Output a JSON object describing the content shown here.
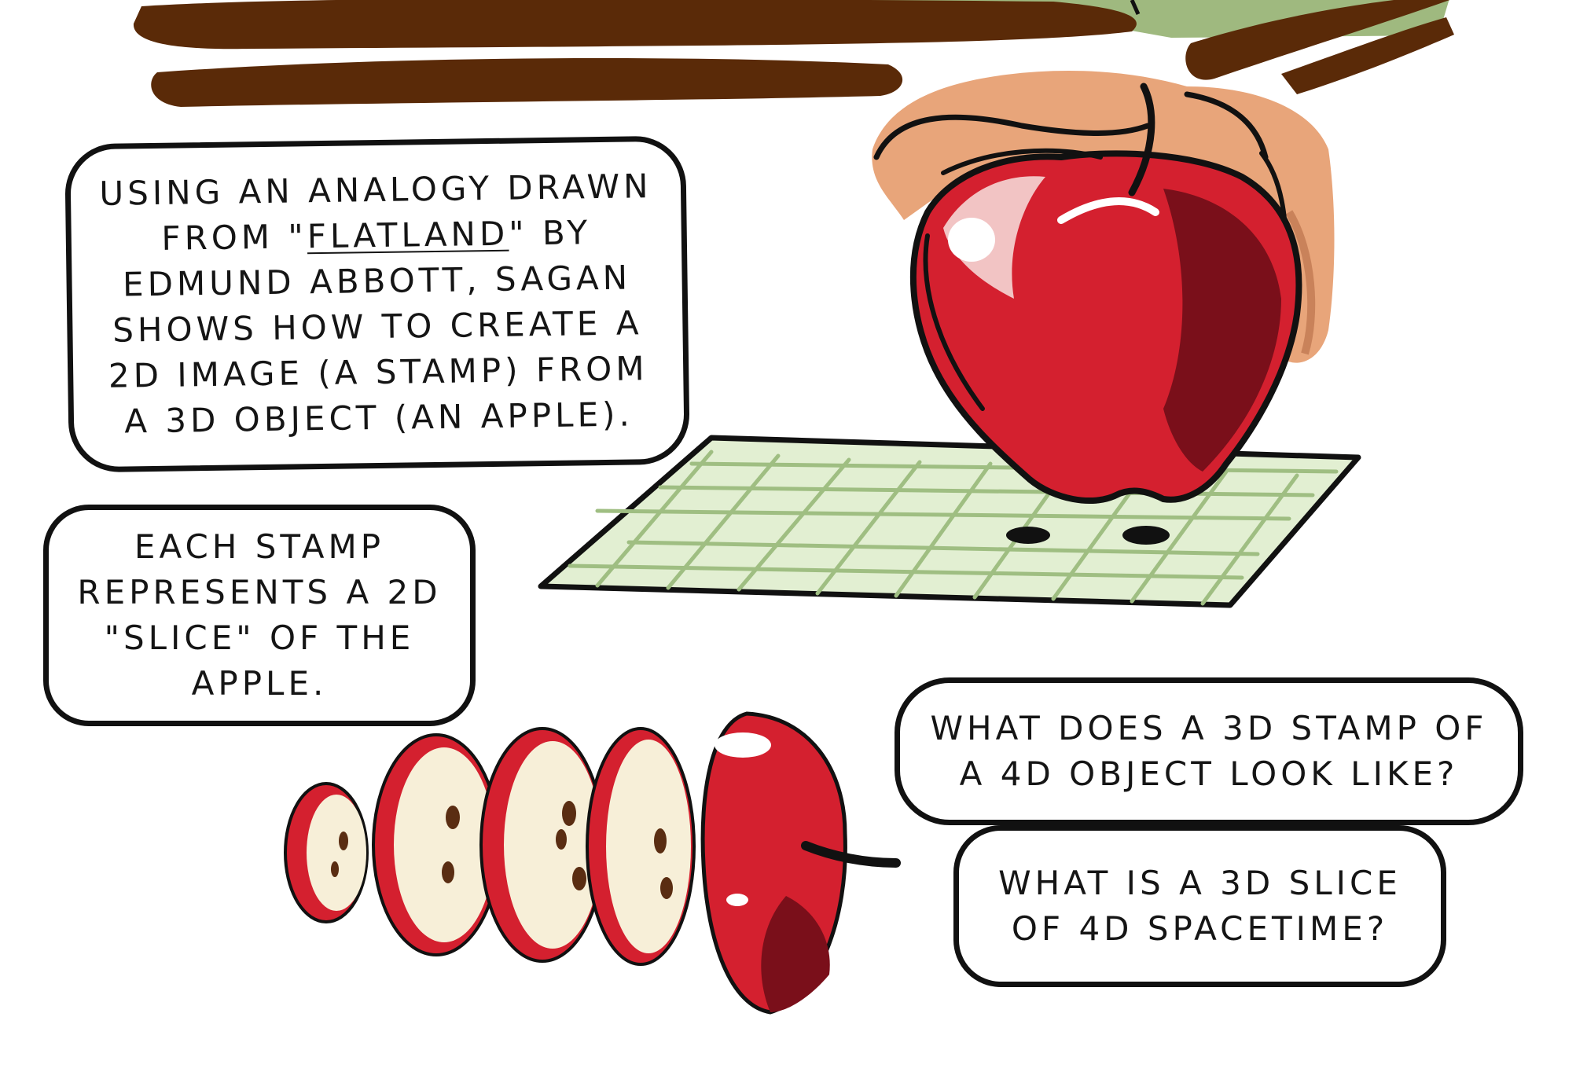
{
  "colors": {
    "apple_red": "#d4202f",
    "apple_dark": "#7a0f1a",
    "slice_flesh": "#f7efd8",
    "seed": "#5a2d12",
    "hand": "#e8a57a",
    "mat": "#e2efd2",
    "mat_lines": "#9fbe82",
    "table_brown": "#5a2a08",
    "background_green": "#9fb97f",
    "ink": "#111111"
  },
  "icons": {
    "hand": "hand-icon",
    "apple": "apple-icon",
    "mat": "grid-mat-icon",
    "slices": "apple-slices-icon"
  },
  "bubbles": {
    "analogy": {
      "before": "USING AN ANALOGY DRAWN FROM \"",
      "book_title": "FLATLAND",
      "after": "\" BY EDMUND ABBOTT, SAGAN SHOWS HOW TO CREATE A 2D IMAGE (A STAMP) FROM A 3D OBJECT (AN APPLE)."
    },
    "stamp": "EACH STAMP REPRESENTS A 2D \"SLICE\" OF THE APPLE.",
    "question_stamp": "WHAT DOES A 3D STAMP OF A 4D OBJECT LOOK LIKE?",
    "question_slice": "WHAT IS A 3D SLICE OF 4D SPACETIME?"
  }
}
